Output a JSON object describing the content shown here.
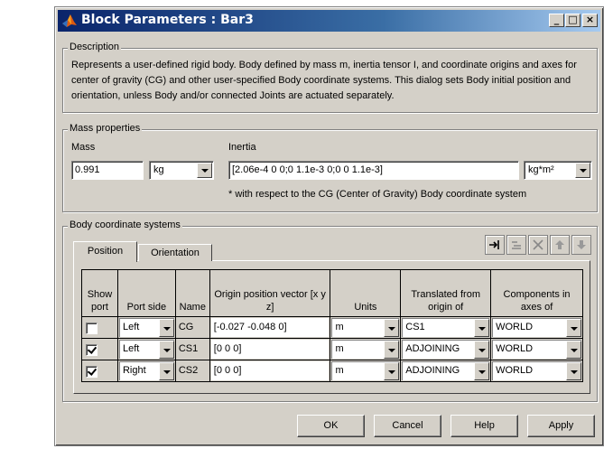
{
  "window": {
    "title": "Block Parameters : Bar3",
    "controls": {
      "minimize": "_",
      "maximize": "□",
      "close": "×"
    }
  },
  "description": {
    "legend": "Description",
    "text": "Represents a user-defined rigid body. Body defined by mass m, inertia tensor I, and coordinate origins and axes for center of gravity (CG) and other user-specified Body coordinate systems. This dialog sets Body initial position and orientation, unless Body and/or connected Joints are actuated separately."
  },
  "mass_properties": {
    "legend": "Mass properties",
    "mass_label": "Mass",
    "mass_value": "0.991",
    "mass_unit": "kg",
    "inertia_label": "Inertia",
    "inertia_value": "[2.06e-4 0 0;0 1.1e-3 0;0 0 1.1e-3]",
    "inertia_unit": "kg*m²",
    "note": "* with respect to the CG (Center of Gravity) Body coordinate system"
  },
  "body_cs": {
    "legend": "Body coordinate systems",
    "tabs": [
      {
        "label": "Position",
        "active": true
      },
      {
        "label": "Orientation",
        "active": false
      }
    ],
    "toolbar": [
      "add-cs-icon",
      "delete-row-icon",
      "close-icon",
      "move-up-icon",
      "move-down-icon"
    ],
    "headers": {
      "show_port": "Show port",
      "port_side": "Port side",
      "name": "Name",
      "origin": "Origin position vector [x y z]",
      "units": "Units",
      "translated": "Translated from origin of",
      "components": "Components in axes of"
    },
    "rows": [
      {
        "show": false,
        "side": "Left",
        "name": "CG",
        "origin": "[-0.027 -0.048 0]",
        "units": "m",
        "translated": "CS1",
        "components": "WORLD"
      },
      {
        "show": true,
        "side": "Left",
        "name": "CS1",
        "origin": "[0 0 0]",
        "units": "m",
        "translated": "ADJOINING",
        "components": "WORLD"
      },
      {
        "show": true,
        "side": "Right",
        "name": "CS2",
        "origin": "[0 0 0]",
        "units": "m",
        "translated": "ADJOINING",
        "components": "WORLD"
      }
    ]
  },
  "buttons": {
    "ok": "OK",
    "cancel": "Cancel",
    "help": "Help",
    "apply": "Apply"
  },
  "colors": {
    "titlebar_start": "#0a246a",
    "titlebar_end": "#a6caf0",
    "face": "#d4d0c8"
  }
}
